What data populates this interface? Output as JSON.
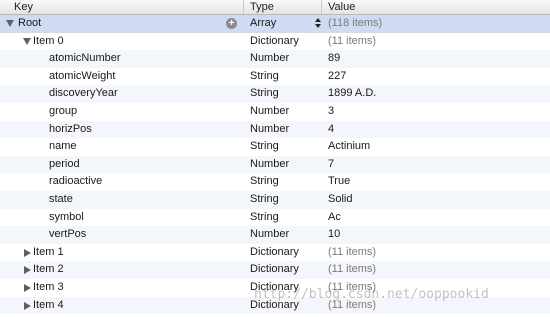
{
  "columns": {
    "key": "Key",
    "type": "Type",
    "value": "Value"
  },
  "root": {
    "key": "Root",
    "type": "Array",
    "value": "(118 items)"
  },
  "item0": {
    "key": "Item 0",
    "type": "Dictionary",
    "value": "(11 items)"
  },
  "fields": [
    {
      "key": "atomicNumber",
      "type": "Number",
      "value": "89"
    },
    {
      "key": "atomicWeight",
      "type": "String",
      "value": "227"
    },
    {
      "key": "discoveryYear",
      "type": "String",
      "value": "1899 A.D."
    },
    {
      "key": "group",
      "type": "Number",
      "value": "3"
    },
    {
      "key": "horizPos",
      "type": "Number",
      "value": "4"
    },
    {
      "key": "name",
      "type": "String",
      "value": "Actinium"
    },
    {
      "key": "period",
      "type": "Number",
      "value": "7"
    },
    {
      "key": "radioactive",
      "type": "String",
      "value": "True"
    },
    {
      "key": "state",
      "type": "String",
      "value": "Solid"
    },
    {
      "key": "symbol",
      "type": "String",
      "value": "Ac"
    },
    {
      "key": "vertPos",
      "type": "Number",
      "value": "10"
    }
  ],
  "collapsed_items": [
    {
      "key": "Item 1",
      "type": "Dictionary",
      "value": "(11 items)"
    },
    {
      "key": "Item 2",
      "type": "Dictionary",
      "value": "(11 items)"
    },
    {
      "key": "Item 3",
      "type": "Dictionary",
      "value": "(11 items)"
    },
    {
      "key": "Item 4",
      "type": "Dictionary",
      "value": "(11 items)"
    }
  ],
  "watermark": "http://blog.csdn.net/ooppookid",
  "colors": {
    "selected_row": "#cfdbf2",
    "alt_row": "#f3f6fa",
    "header_bg": "#e3e3e3"
  },
  "icons": {
    "add": "plus-circle-icon",
    "disclosure": "disclosure-triangle-icon",
    "stepper": "stepper-icon"
  }
}
